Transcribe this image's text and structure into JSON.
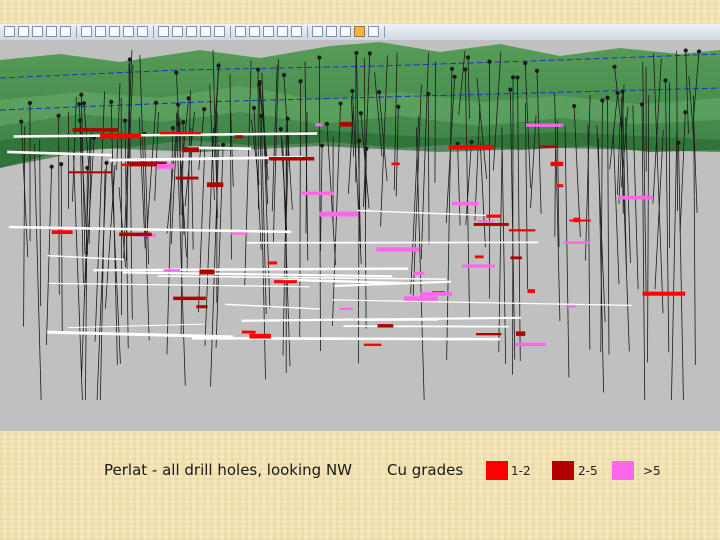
{
  "slide": {
    "caption": "Perlat - all drill holes, looking NW",
    "legend_title": "Cu grades"
  },
  "legend": [
    {
      "label": "1-2",
      "color": "#ff0000"
    },
    {
      "label": "2-5",
      "color": "#b00000"
    },
    {
      "label": ">5",
      "color": "#ff66ee"
    }
  ],
  "toolbar": {
    "icons": [
      "open-icon",
      "save-icon",
      "print-icon",
      "cut-icon",
      "copy-icon",
      "paste-icon",
      "undo-icon",
      "rotate-icon",
      "zoom-in-icon",
      "zoom-out-icon",
      "pan-icon",
      "select-icon",
      "measure-icon",
      "line-icon",
      "polyline-icon",
      "section-icon",
      "grid-icon",
      "layer-icon",
      "view-icon",
      "color-icon",
      "light-icon",
      "render-icon",
      "sun-icon",
      "active-view-icon",
      "settings-icon"
    ]
  },
  "scene": {
    "background_color": "#c0c0c0",
    "terrain_color": "#3f8a3f",
    "drillhole_color": "#1a1a1a",
    "section_line_color": "#ffffff",
    "contour_line_color": "#2030c0"
  }
}
